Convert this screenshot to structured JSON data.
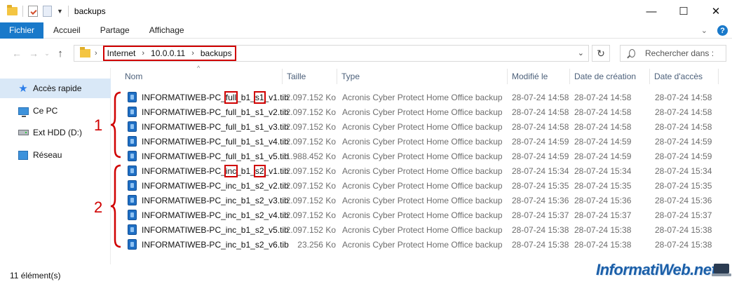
{
  "window": {
    "title": "backups",
    "minimize_glyph": "—",
    "maximize_glyph": "☐",
    "close_glyph": "✕"
  },
  "ribbon": {
    "tabs": [
      "Fichier",
      "Accueil",
      "Partage",
      "Affichage"
    ],
    "help_glyph": "?"
  },
  "address": {
    "crumbs": [
      "Internet",
      "10.0.0.11",
      "backups"
    ],
    "search_placeholder": "Rechercher dans :"
  },
  "sidebar": {
    "items": [
      {
        "label": "Accès rapide",
        "icon": "star-icon"
      },
      {
        "label": "Ce PC",
        "icon": "monitor-icon"
      },
      {
        "label": "Ext HDD (D:)",
        "icon": "hdd-icon"
      },
      {
        "label": "Réseau",
        "icon": "network-icon"
      }
    ]
  },
  "columns": {
    "name": "Nom",
    "size": "Taille",
    "type": "Type",
    "modified": "Modifié le",
    "created": "Date de création",
    "accessed": "Date d'accès"
  },
  "files": [
    {
      "name": "INFORMATIWEB-PC_full_b1_s1_v1.tib",
      "size": "2.097.152 Ko",
      "type": "Acronis Cyber Protect Home Office backup",
      "modified": "28-07-24 14:58",
      "created": "28-07-24 14:58",
      "accessed": "28-07-24 14:58"
    },
    {
      "name": "INFORMATIWEB-PC_full_b1_s1_v2.tib",
      "size": "2.097.152 Ko",
      "type": "Acronis Cyber Protect Home Office backup",
      "modified": "28-07-24 14:58",
      "created": "28-07-24 14:58",
      "accessed": "28-07-24 14:58"
    },
    {
      "name": "INFORMATIWEB-PC_full_b1_s1_v3.tib",
      "size": "2.097.152 Ko",
      "type": "Acronis Cyber Protect Home Office backup",
      "modified": "28-07-24 14:58",
      "created": "28-07-24 14:58",
      "accessed": "28-07-24 14:58"
    },
    {
      "name": "INFORMATIWEB-PC_full_b1_s1_v4.tib",
      "size": "2.097.152 Ko",
      "type": "Acronis Cyber Protect Home Office backup",
      "modified": "28-07-24 14:59",
      "created": "28-07-24 14:59",
      "accessed": "28-07-24 14:59"
    },
    {
      "name": "INFORMATIWEB-PC_full_b1_s1_v5.tib",
      "size": "1.988.452 Ko",
      "type": "Acronis Cyber Protect Home Office backup",
      "modified": "28-07-24 14:59",
      "created": "28-07-24 14:59",
      "accessed": "28-07-24 14:59"
    },
    {
      "name": "INFORMATIWEB-PC_inc_b1_s2_v1.tib",
      "size": "2.097.152 Ko",
      "type": "Acronis Cyber Protect Home Office backup",
      "modified": "28-07-24 15:34",
      "created": "28-07-24 15:34",
      "accessed": "28-07-24 15:34"
    },
    {
      "name": "INFORMATIWEB-PC_inc_b1_s2_v2.tib",
      "size": "2.097.152 Ko",
      "type": "Acronis Cyber Protect Home Office backup",
      "modified": "28-07-24 15:35",
      "created": "28-07-24 15:35",
      "accessed": "28-07-24 15:35"
    },
    {
      "name": "INFORMATIWEB-PC_inc_b1_s2_v3.tib",
      "size": "2.097.152 Ko",
      "type": "Acronis Cyber Protect Home Office backup",
      "modified": "28-07-24 15:36",
      "created": "28-07-24 15:36",
      "accessed": "28-07-24 15:36"
    },
    {
      "name": "INFORMATIWEB-PC_inc_b1_s2_v4.tib",
      "size": "2.097.152 Ko",
      "type": "Acronis Cyber Protect Home Office backup",
      "modified": "28-07-24 15:37",
      "created": "28-07-24 15:37",
      "accessed": "28-07-24 15:37"
    },
    {
      "name": "INFORMATIWEB-PC_inc_b1_s2_v5.tib",
      "size": "2.097.152 Ko",
      "type": "Acronis Cyber Protect Home Office backup",
      "modified": "28-07-24 15:38",
      "created": "28-07-24 15:38",
      "accessed": "28-07-24 15:38"
    },
    {
      "name": "INFORMATIWEB-PC_inc_b1_s2_v6.tib",
      "size": "23.256 Ko",
      "type": "Acronis Cyber Protect Home Office backup",
      "modified": "28-07-24 15:38",
      "created": "28-07-24 15:38",
      "accessed": "28-07-24 15:38"
    }
  ],
  "annotations": {
    "group1": "1",
    "group2": "2",
    "color": "#d00000"
  },
  "status": {
    "count": "11 élément(s)"
  },
  "watermark": "InformatiWeb.net"
}
